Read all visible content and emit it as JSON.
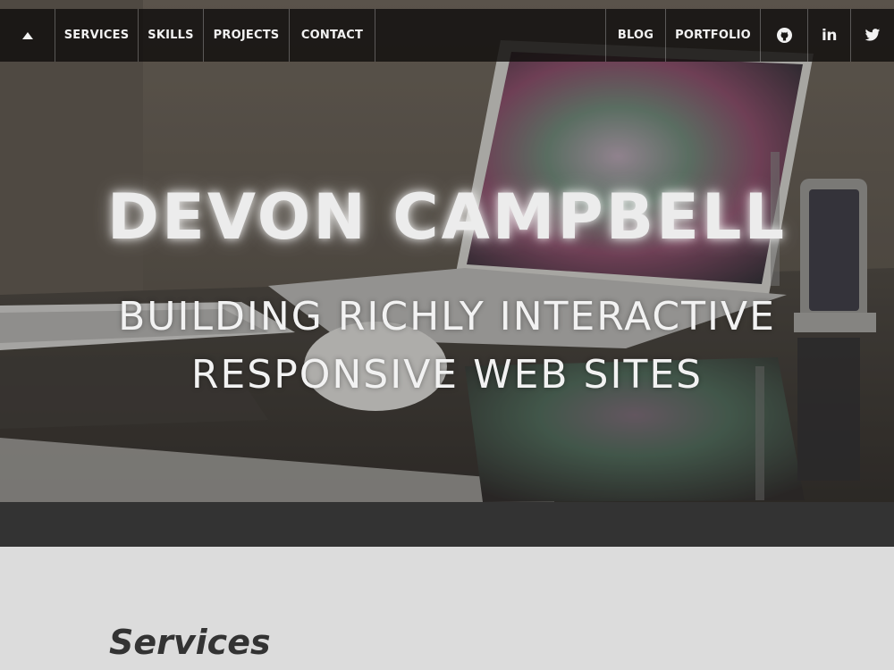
{
  "nav": {
    "left_items": [
      {
        "label": "SERVICES"
      },
      {
        "label": "SKILLS"
      },
      {
        "label": "PROJECTS"
      },
      {
        "label": "CONTACT"
      }
    ],
    "right_items": [
      {
        "label": "BLOG"
      },
      {
        "label": "PORTFOLIO"
      }
    ],
    "icons": {
      "top": "up-arrow-icon",
      "github": "github-icon",
      "linkedin": "linkedin-icon",
      "twitter": "twitter-icon"
    },
    "linkedin_glyph": "in"
  },
  "hero": {
    "name": "DEVON CAMPBELL",
    "tagline_line1": "BUILDING RICHLY INTERACTIVE",
    "tagline_line2": "RESPONSIVE WEB SITES"
  },
  "services": {
    "heading": "Services"
  },
  "colors": {
    "nav_bg": "#12100e",
    "nav_text": "#f2f2f2",
    "strip": "#333333",
    "section_bg": "#dcdcdc",
    "heading_text": "#333333"
  }
}
